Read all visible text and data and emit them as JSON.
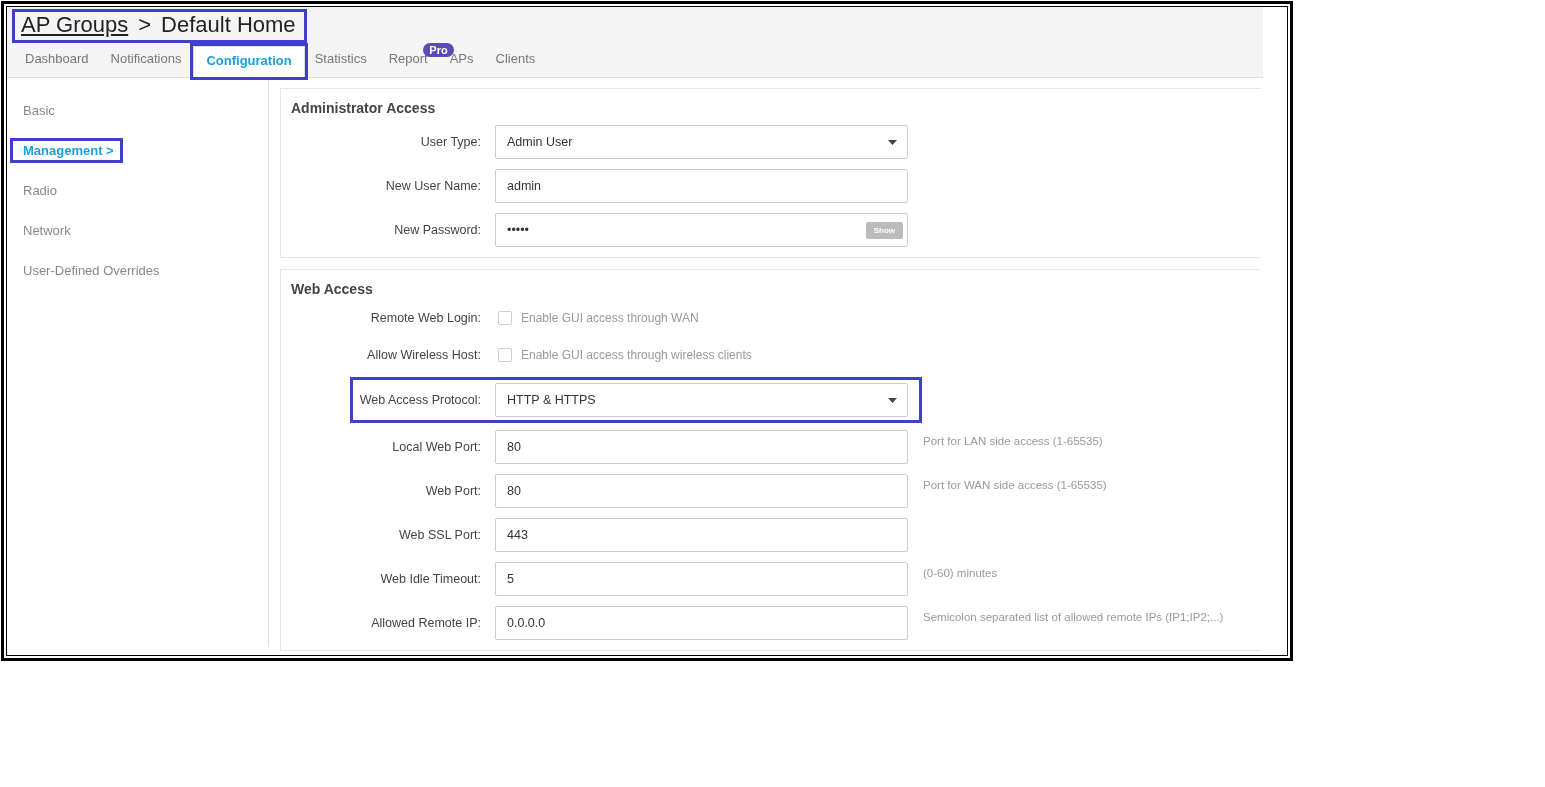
{
  "breadcrumb": {
    "link": "AP Groups",
    "separator": ">",
    "current": "Default Home",
    "highlighted": true
  },
  "tabs": [
    {
      "label": "Dashboard",
      "selected": false,
      "highlighted": false
    },
    {
      "label": "Notifications",
      "selected": false,
      "highlighted": false
    },
    {
      "label": "Configuration",
      "selected": true,
      "highlighted": true
    },
    {
      "label": "Statistics",
      "selected": false,
      "highlighted": false
    },
    {
      "label": "Report",
      "selected": false,
      "highlighted": false,
      "badge": "Pro"
    },
    {
      "label": "APs",
      "selected": false,
      "highlighted": false
    },
    {
      "label": "Clients",
      "selected": false,
      "highlighted": false
    }
  ],
  "sidebar": {
    "items": [
      {
        "label": "Basic",
        "selected": false,
        "highlighted": false
      },
      {
        "label": "Management",
        "chevron": ">",
        "selected": true,
        "highlighted": true
      },
      {
        "label": "Radio",
        "selected": false,
        "highlighted": false
      },
      {
        "label": "Network",
        "selected": false,
        "highlighted": false
      },
      {
        "label": "User-Defined Overrides",
        "selected": false,
        "highlighted": false
      }
    ]
  },
  "panels": [
    {
      "title": "Administrator Access",
      "fields": [
        {
          "kind": "select",
          "label": "User Type:",
          "value": "Admin User",
          "highlighted": false
        },
        {
          "kind": "text",
          "label": "New User Name:",
          "value": "admin",
          "highlighted": false
        },
        {
          "kind": "password",
          "label": "New Password:",
          "value": "•••••",
          "button": "Show",
          "highlighted": false
        }
      ]
    },
    {
      "title": "Web Access",
      "fields": [
        {
          "kind": "checkbox",
          "label": "Remote Web Login:",
          "checked": false,
          "text": "Enable GUI access through WAN",
          "highlighted": false
        },
        {
          "kind": "checkbox",
          "label": "Allow Wireless Host:",
          "checked": false,
          "text": "Enable GUI access through wireless clients",
          "highlighted": false
        },
        {
          "kind": "select",
          "label": "Web Access Protocol:",
          "value": "HTTP & HTTPS",
          "highlighted": true
        },
        {
          "kind": "text",
          "label": "Local Web Port:",
          "value": "80",
          "hint": "Port for LAN side access (1-65535)",
          "highlighted": false
        },
        {
          "kind": "text",
          "label": "Web Port:",
          "value": "80",
          "hint": "Port for WAN side access (1-65535)",
          "highlighted": false
        },
        {
          "kind": "text",
          "label": "Web SSL Port:",
          "value": "443",
          "highlighted": false
        },
        {
          "kind": "text",
          "label": "Web Idle Timeout:",
          "value": "5",
          "hint": "(0-60) minutes",
          "highlighted": false
        },
        {
          "kind": "text",
          "label": "Allowed Remote IP:",
          "value": "0.0.0.0",
          "hint": "Semicolon separated list of allowed remote IPs (IP1;IP2;...)",
          "highlighted": false
        }
      ]
    }
  ]
}
